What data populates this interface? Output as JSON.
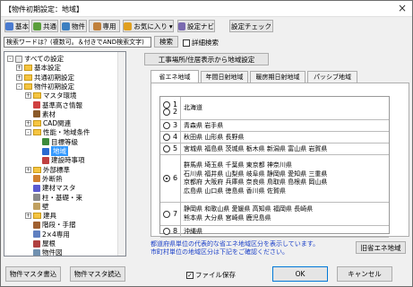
{
  "window": {
    "title": "【物件初期設定：地域】",
    "close": "×"
  },
  "toolbar": [
    {
      "label": "基本",
      "icon": "basic-icon",
      "color": "#4a7bd0"
    },
    {
      "label": "共通",
      "icon": "common-icon",
      "color": "#5a9e3c"
    },
    {
      "label": "物件",
      "icon": "property-icon",
      "color": "#3c7fc0"
    },
    {
      "label": "専用",
      "icon": "dedicated-icon",
      "color": "#c0803c"
    },
    {
      "label": "お気に入り",
      "icon": "favorite-icon",
      "color": "#e0a020"
    },
    {
      "label": "設定ナビ",
      "icon": "settings-nav-icon",
      "color": "#7a6ab0"
    },
    {
      "label": "設定チェック",
      "icon": "",
      "color": ""
    }
  ],
  "search": {
    "placeholder": "検索ワードは？(複数可。＆付きでAND検索文字)",
    "button": "検索",
    "detail_label": "詳細検索"
  },
  "tree": [
    {
      "label": "すべての設定",
      "level": 0,
      "exp": "-",
      "type": "root"
    },
    {
      "label": "基本設定",
      "level": 1,
      "exp": "+",
      "type": "folder"
    },
    {
      "label": "共通初期設定",
      "level": 1,
      "exp": "+",
      "type": "folder"
    },
    {
      "label": "物件初期設定",
      "level": 1,
      "exp": "-",
      "type": "folder"
    },
    {
      "label": "マスタ環境",
      "level": 2,
      "exp": "+",
      "type": "folder"
    },
    {
      "label": "基準高さ情報",
      "level": 2,
      "exp": "",
      "type": "leaf",
      "color": "#d04040"
    },
    {
      "label": "素材",
      "level": 2,
      "exp": "",
      "type": "leaf",
      "color": "#8a5a2a"
    },
    {
      "label": "CAD関連",
      "level": 2,
      "exp": "+",
      "type": "folder"
    },
    {
      "label": "性能・地域条件",
      "level": 2,
      "exp": "-",
      "type": "folder"
    },
    {
      "label": "目標等級",
      "level": 3,
      "exp": "",
      "type": "leaf",
      "color": "#3c8a3c"
    },
    {
      "label": "地域",
      "level": 3,
      "exp": "",
      "type": "leaf",
      "color": "#2a6ad0",
      "selected": true
    },
    {
      "label": "建設時事項",
      "level": 3,
      "exp": "",
      "type": "leaf",
      "color": "#c04040"
    },
    {
      "label": "外部標準",
      "level": 2,
      "exp": "+",
      "type": "folder"
    },
    {
      "label": "外断熱",
      "level": 2,
      "exp": "",
      "type": "leaf",
      "color": "#d08030"
    },
    {
      "label": "建材マスタ",
      "level": 2,
      "exp": "",
      "type": "leaf",
      "color": "#5a5ad0"
    },
    {
      "label": "柱・基礎・束",
      "level": 2,
      "exp": "",
      "type": "leaf",
      "color": "#8a8a8a"
    },
    {
      "label": "壁",
      "level": 2,
      "exp": "",
      "type": "leaf",
      "color": "#c0a060"
    },
    {
      "label": "建具",
      "level": 2,
      "exp": "+",
      "type": "folder"
    },
    {
      "label": "階段・手摺",
      "level": 2,
      "exp": "",
      "type": "leaf",
      "color": "#a06030"
    },
    {
      "label": "2×4専用",
      "level": 2,
      "exp": "",
      "type": "leaf",
      "color": "#6080c0"
    },
    {
      "label": "屋根",
      "level": 2,
      "exp": "",
      "type": "leaf",
      "color": "#b04040"
    },
    {
      "label": "物件図",
      "level": 2,
      "exp": "",
      "type": "leaf",
      "color": "#7090b0"
    }
  ],
  "property_button": "工事場所/住居表示から地域設定",
  "tabs": [
    "省エネ地域",
    "年間日射地域",
    "暖房期日射地域",
    "パッシブ地域"
  ],
  "regions": [
    {
      "nums": [
        "1",
        "2"
      ],
      "prefs": [
        "北海道"
      ],
      "selected": false
    },
    {
      "nums": [
        "3"
      ],
      "prefs": [
        "青森県 岩手県"
      ],
      "selected": false
    },
    {
      "nums": [
        "4"
      ],
      "prefs": [
        "秋田県 山形県 長野県"
      ],
      "selected": false
    },
    {
      "nums": [
        "5"
      ],
      "prefs": [
        "宮城県 福島県 茨城県 栃木県 新潟県 富山県 岩賀県"
      ],
      "selected": false
    },
    {
      "nums": [
        "6"
      ],
      "prefs": [
        "群馬県 埼玉県 千葉県 東京都 神奈川県",
        "石川県 福井県 山梨県 岐阜県 静岡県 愛知県 三重県",
        "京都府 大阪府 兵庫県 奈良県 鳥取県 島根県 岡山県",
        "広島県 山口県 徳島県 香川県 佐賀県"
      ],
      "selected": true
    },
    {
      "nums": [
        "7"
      ],
      "prefs": [
        "静岡県 和歌山県 愛媛県 高知県 福岡県 長崎県",
        "熊本県 大分県 宮崎県 鹿児島県"
      ],
      "selected": false
    },
    {
      "nums": [
        "8"
      ],
      "prefs": [
        "沖縄県"
      ],
      "selected": false
    }
  ],
  "note": [
    "都道府県単位の代表的な省エネ地域区分を表示しています。",
    "市町村単位の地域区分は下記をご確認ください。"
  ],
  "old_region_button": "旧省エネ地域",
  "footer": {
    "master_write": "物件マスタ書込",
    "master_read": "物件マスタ読込",
    "file_save": "ファイル保存",
    "file_save_checked": true,
    "ok": "OK",
    "cancel": "キャンセル"
  }
}
